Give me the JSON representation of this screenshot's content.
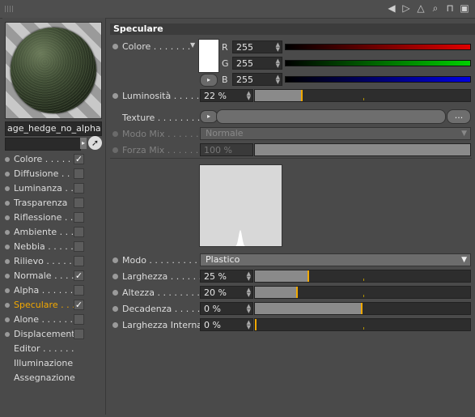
{
  "material_name": "age_hedge_no_alpha",
  "channels": [
    {
      "label": "Colore . . . . .",
      "checked": true,
      "active": false
    },
    {
      "label": "Diffusione . . .",
      "checked": false,
      "active": false
    },
    {
      "label": "Luminanza . . .",
      "checked": false,
      "active": false
    },
    {
      "label": "Trasparenza",
      "checked": false,
      "active": false
    },
    {
      "label": "Riflessione . . .",
      "checked": false,
      "active": false
    },
    {
      "label": "Ambiente . . . .",
      "checked": false,
      "active": false
    },
    {
      "label": "Nebbia . . . . .",
      "checked": false,
      "active": false
    },
    {
      "label": "Rilievo . . . . .",
      "checked": false,
      "active": false
    },
    {
      "label": "Normale . . . .",
      "checked": true,
      "active": false
    },
    {
      "label": "Alpha . . . . . .",
      "checked": false,
      "active": false
    },
    {
      "label": "Speculare . . .",
      "checked": true,
      "active": true
    },
    {
      "label": "Alone . . . . . .",
      "checked": false,
      "active": false
    },
    {
      "label": "Displacement",
      "checked": false,
      "active": false
    }
  ],
  "extra_items": [
    "Editor . . . . . .",
    "Illuminazione",
    "Assegnazione"
  ],
  "section_title": "Speculare",
  "color": {
    "label": "Colore . . . . . . .",
    "r_label": "R",
    "r": "255",
    "g_label": "G",
    "g": "255",
    "b_label": "B",
    "b": "255",
    "swatch": "#ffffff"
  },
  "luminosita": {
    "label": "Luminosità . . . . . .",
    "value": "22 %",
    "fraction": 0.22
  },
  "texture": {
    "label": "Texture . . . . . . . .",
    "button": "..."
  },
  "modo_mix": {
    "label": "Modo Mix . . . . . .",
    "value": "Normale"
  },
  "forza_mix": {
    "label": "Forza Mix . . . . . .",
    "value": "100 %",
    "fraction": 1.0
  },
  "modo": {
    "label": "Modo . . . . . . . . . . .",
    "value": "Plastico"
  },
  "larghezza": {
    "label": "Larghezza . . . . . . .",
    "value": "25 %",
    "fraction": 0.25
  },
  "altezza": {
    "label": "Altezza . . . . . . . . .",
    "value": "20 %",
    "fraction": 0.2
  },
  "decadenza": {
    "label": "Decadenza . . . . . .",
    "value": "0 %",
    "fraction": 0.5
  },
  "larghezza_interna": {
    "label": "Larghezza Interna",
    "value": "0 %",
    "fraction": 0.0
  },
  "accent_color": "#f0a800"
}
